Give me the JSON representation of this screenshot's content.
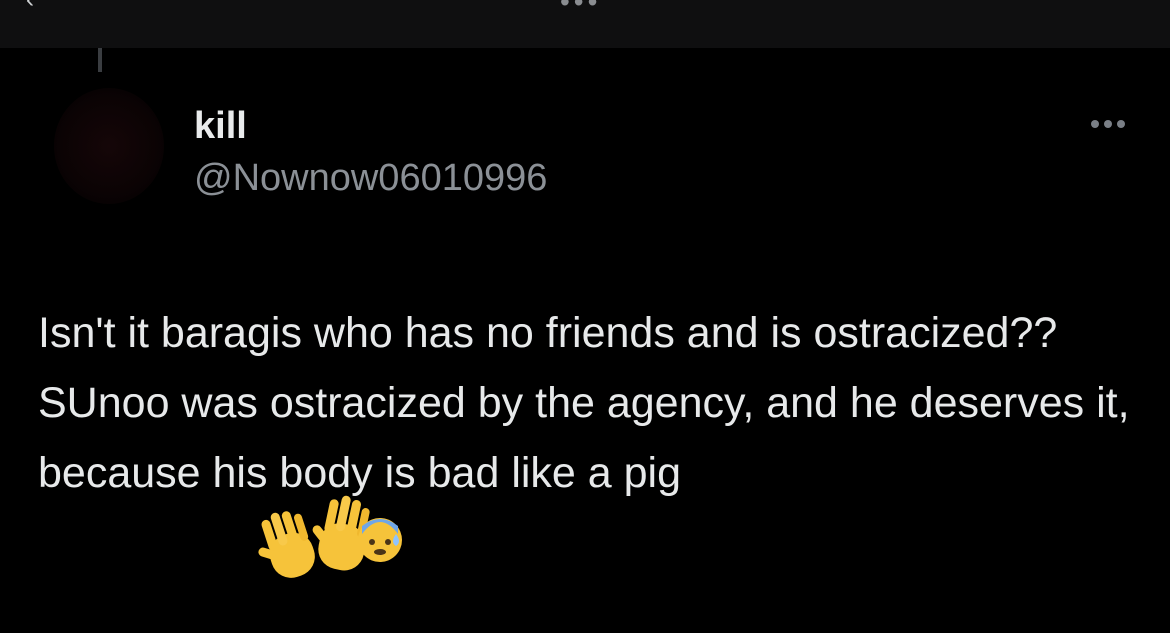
{
  "tweet": {
    "display_name": "kill",
    "handle": "@Nownow06010996",
    "text": "Isn't it baragis who has no friends and is ostracized?? SUnoo was ostracized by the agency, and he deserves it, because his body is bad like a pig",
    "emojis": [
      "waving-hand",
      "raised-hand",
      "anxious-face-with-sweat"
    ]
  },
  "icons": {
    "more": "more-horizontal-icon",
    "back": "back-arrow-icon",
    "avatar": "avatar"
  },
  "colors": {
    "background": "#000000",
    "text_primary": "#e7e9ea",
    "text_secondary": "#8b9096",
    "emoji_yellow": "#f6c33a"
  }
}
